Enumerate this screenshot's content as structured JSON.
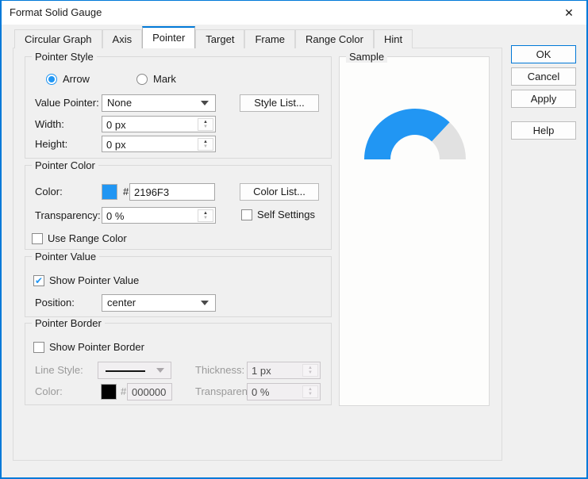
{
  "window": {
    "title": "Format Solid Gauge",
    "close_glyph": "✕"
  },
  "tabs": [
    {
      "label": "Circular Graph",
      "active": false
    },
    {
      "label": "Axis",
      "active": false
    },
    {
      "label": "Pointer",
      "active": true
    },
    {
      "label": "Target",
      "active": false
    },
    {
      "label": "Frame",
      "active": false
    },
    {
      "label": "Range Color",
      "active": false
    },
    {
      "label": "Hint",
      "active": false
    }
  ],
  "pointer_style": {
    "legend": "Pointer Style",
    "radio_arrow_label": "Arrow",
    "radio_arrow_checked": true,
    "radio_mark_label": "Mark",
    "radio_mark_checked": false,
    "value_pointer_label": "Value Pointer:",
    "value_pointer_value": "None",
    "style_list_button": "Style List...",
    "width_label": "Width:",
    "width_value": "0 px",
    "height_label": "Height:",
    "height_value": "0 px"
  },
  "pointer_color": {
    "legend": "Pointer Color",
    "color_label": "Color:",
    "hash": "#",
    "color_hex": "2196F3",
    "swatch_color": "#2196F3",
    "color_list_button": "Color List...",
    "transparency_label": "Transparency:",
    "transparency_value": "0 %",
    "self_settings_label": "Self Settings",
    "self_settings_checked": false,
    "use_range_color_label": "Use Range Color",
    "use_range_color_checked": false
  },
  "pointer_value": {
    "legend": "Pointer Value",
    "show_label": "Show Pointer Value",
    "show_checked": true,
    "position_label": "Position:",
    "position_value": "center"
  },
  "pointer_border": {
    "legend": "Pointer Border",
    "show_label": "Show Pointer Border",
    "show_checked": false,
    "line_style_label": "Line Style:",
    "thickness_label": "Thickness:",
    "thickness_value": "1 px",
    "color_label": "Color:",
    "hash": "#",
    "color_hex": "000000",
    "swatch_color": "#000000",
    "transparency_label": "Transparency:",
    "transparency_value": "0 %"
  },
  "sample": {
    "legend": "Sample"
  },
  "chart_data": {
    "type": "gauge",
    "shape": "half-donut",
    "title": "Sample",
    "value_fraction": 0.74,
    "fill_from_deg": 180,
    "fill_to_deg": 47,
    "end_angle_deg": 0,
    "pointer_color": "#2196F3",
    "track_color": "#e1e1e1"
  },
  "buttons": {
    "ok": "OK",
    "cancel": "Cancel",
    "apply": "Apply",
    "help": "Help"
  },
  "colors": {
    "accent": "#0078d7",
    "pointer_blue": "#2196F3",
    "track_gray": "#e1e1e1"
  }
}
